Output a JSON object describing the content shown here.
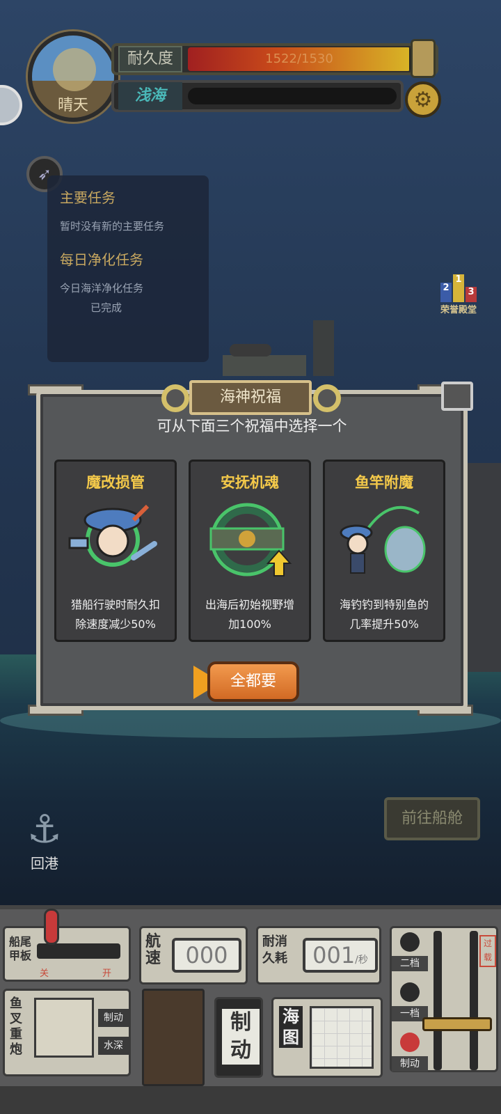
{
  "status": {
    "weather": "晴天",
    "durability_label": "耐久度",
    "durability_value": "1522/1530",
    "durability_fraction": 0.995,
    "mode_label": "浅海"
  },
  "quests": {
    "main_title": "主要任务",
    "main_text": "暂时没有新的主要任务",
    "daily_title": "每日净化任务",
    "daily_text": "今日海洋净化任务",
    "daily_status": "已完成"
  },
  "rank": {
    "label": "荣誉殿堂",
    "places": [
      "2",
      "1",
      "3"
    ]
  },
  "dialog": {
    "title": "海神祝福",
    "subtitle": "可从下面三个祝福中选择一个",
    "cards": [
      {
        "title": "魔改损管",
        "desc_line1": "猎船行驶时耐久扣",
        "desc_line2": "除速度减少50%"
      },
      {
        "title": "安抚机魂",
        "desc_line1": "出海后初始视野增",
        "desc_line2": "加100%"
      },
      {
        "title": "鱼竿附魔",
        "desc_line1": "海钓钓到特别鱼的",
        "desc_line2": "几率提升50%"
      }
    ],
    "take_all": "全都要"
  },
  "actions": {
    "return_port": "回港",
    "go_cabin": "前往船舱"
  },
  "panel": {
    "stern_label_1": "船尾",
    "stern_label_2": "甲板",
    "stern_off": "关",
    "stern_on": "开",
    "speed_label_1": "航",
    "speed_label_2": "速",
    "speed_value": "000",
    "consume_label": "耐消",
    "consume_label2": "久耗",
    "consume_value": "001",
    "consume_unit": "/秒",
    "gear_2": "二档",
    "gear_1": "一档",
    "brake_small": "制动",
    "overload": "过载",
    "harpoon_label": "鱼叉重炮",
    "brake_btn": "制动",
    "depth_btn": "水深",
    "big_brake_1": "制",
    "big_brake_2": "动",
    "map_1": "海",
    "map_2": "图"
  }
}
